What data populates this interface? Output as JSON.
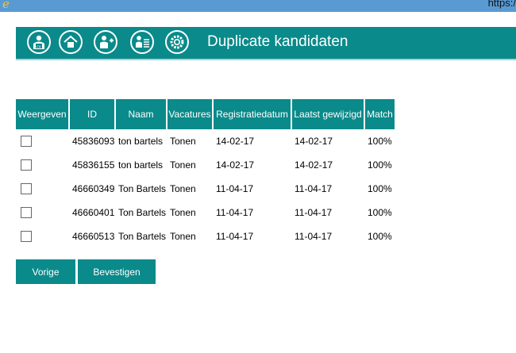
{
  "browser": {
    "url_fragment": "https:/"
  },
  "app": {
    "title": "Duplicate kandidaten",
    "nav_icons": [
      "cv-user-icon",
      "home-icon",
      "add-user-icon",
      "candidate-list-icon",
      "settings-gear-icon"
    ],
    "accent_color": "#0a8a8a"
  },
  "table": {
    "headers": [
      "Weergeven",
      "ID",
      "Naam",
      "Vacatures",
      "Registratiedatum",
      "Laatst gewijzigd",
      "Match"
    ],
    "rows": [
      {
        "checked": false,
        "id": "45836093",
        "naam": "ton bartels",
        "vacatures": "Tonen",
        "registratiedatum": "14-02-17",
        "laatst_gewijzigd": "14-02-17",
        "match": "100%"
      },
      {
        "checked": false,
        "id": "45836155",
        "naam": "ton bartels",
        "vacatures": "Tonen",
        "registratiedatum": "14-02-17",
        "laatst_gewijzigd": "14-02-17",
        "match": "100%"
      },
      {
        "checked": false,
        "id": "46660349",
        "naam": "Ton Bartels",
        "vacatures": "Tonen",
        "registratiedatum": "11-04-17",
        "laatst_gewijzigd": "11-04-17",
        "match": "100%"
      },
      {
        "checked": false,
        "id": "46660401",
        "naam": "Ton Bartels",
        "vacatures": "Tonen",
        "registratiedatum": "11-04-17",
        "laatst_gewijzigd": "11-04-17",
        "match": "100%"
      },
      {
        "checked": false,
        "id": "46660513",
        "naam": "Ton Bartels",
        "vacatures": "Tonen",
        "registratiedatum": "11-04-17",
        "laatst_gewijzigd": "11-04-17",
        "match": "100%"
      }
    ]
  },
  "buttons": {
    "back_label": "Vorige",
    "confirm_label": "Bevestigen"
  }
}
